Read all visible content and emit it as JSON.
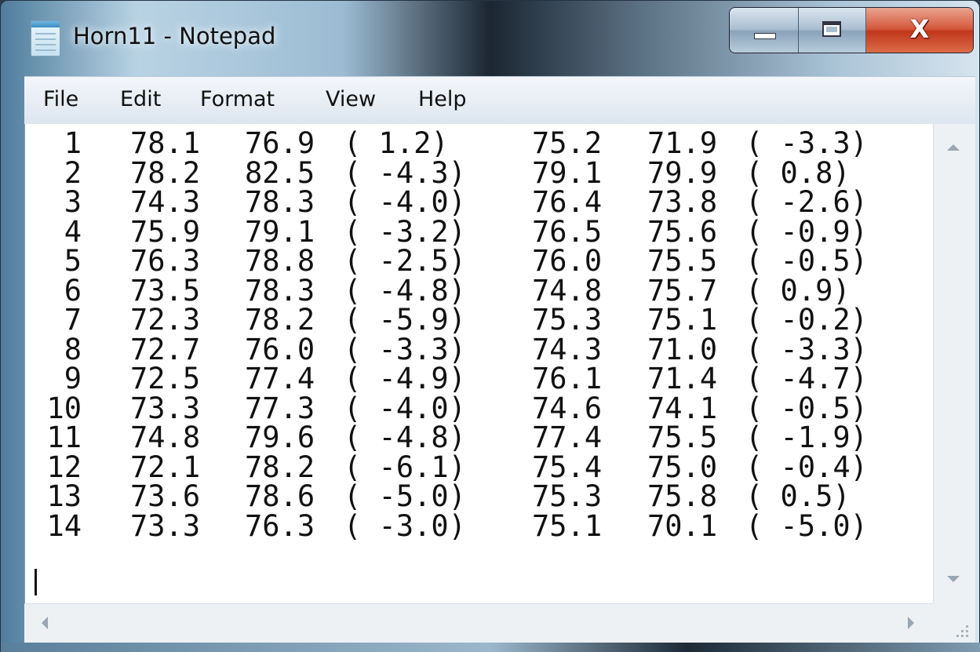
{
  "window": {
    "title": "Horn11 - Notepad",
    "close_glyph": "X"
  },
  "menu": [
    {
      "label": "File"
    },
    {
      "label": "Edit"
    },
    {
      "label": "Format"
    },
    {
      "label": "View"
    },
    {
      "label": "Help"
    }
  ],
  "editor": {
    "rows": [
      {
        "n": "1",
        "a": "78.1",
        "b": "76.9",
        "d1": "( 1.2)",
        "c": "75.2",
        "e": "71.9",
        "d2": "( -3.3)"
      },
      {
        "n": "2",
        "a": "78.2",
        "b": "82.5",
        "d1": "( -4.3)",
        "c": "79.1",
        "e": "79.9",
        "d2": "( 0.8)"
      },
      {
        "n": "3",
        "a": "74.3",
        "b": "78.3",
        "d1": "( -4.0)",
        "c": "76.4",
        "e": "73.8",
        "d2": "( -2.6)"
      },
      {
        "n": "4",
        "a": "75.9",
        "b": "79.1",
        "d1": "( -3.2)",
        "c": "76.5",
        "e": "75.6",
        "d2": "( -0.9)"
      },
      {
        "n": "5",
        "a": "76.3",
        "b": "78.8",
        "d1": "( -2.5)",
        "c": "76.0",
        "e": "75.5",
        "d2": "( -0.5)"
      },
      {
        "n": "6",
        "a": "73.5",
        "b": "78.3",
        "d1": "( -4.8)",
        "c": "74.8",
        "e": "75.7",
        "d2": "( 0.9)"
      },
      {
        "n": "7",
        "a": "72.3",
        "b": "78.2",
        "d1": "( -5.9)",
        "c": "75.3",
        "e": "75.1",
        "d2": "( -0.2)"
      },
      {
        "n": "8",
        "a": "72.7",
        "b": "76.0",
        "d1": "( -3.3)",
        "c": "74.3",
        "e": "71.0",
        "d2": "( -3.3)"
      },
      {
        "n": "9",
        "a": "72.5",
        "b": "77.4",
        "d1": "( -4.9)",
        "c": "76.1",
        "e": "71.4",
        "d2": "( -4.7)"
      },
      {
        "n": "10",
        "a": "73.3",
        "b": "77.3",
        "d1": "( -4.0)",
        "c": "74.6",
        "e": "74.1",
        "d2": "( -0.5)"
      },
      {
        "n": "11",
        "a": "74.8",
        "b": "79.6",
        "d1": "( -4.8)",
        "c": "77.4",
        "e": "75.5",
        "d2": "( -1.9)"
      },
      {
        "n": "12",
        "a": "72.1",
        "b": "78.2",
        "d1": "( -6.1)",
        "c": "75.4",
        "e": "75.0",
        "d2": "( -0.4)"
      },
      {
        "n": "13",
        "a": "73.6",
        "b": "78.6",
        "d1": "( -5.0)",
        "c": "75.3",
        "e": "75.8",
        "d2": "( 0.5)"
      },
      {
        "n": "14",
        "a": "73.3",
        "b": "76.3",
        "d1": "( -3.0)",
        "c": "75.1",
        "e": "70.1",
        "d2": "( -5.0)"
      }
    ]
  }
}
